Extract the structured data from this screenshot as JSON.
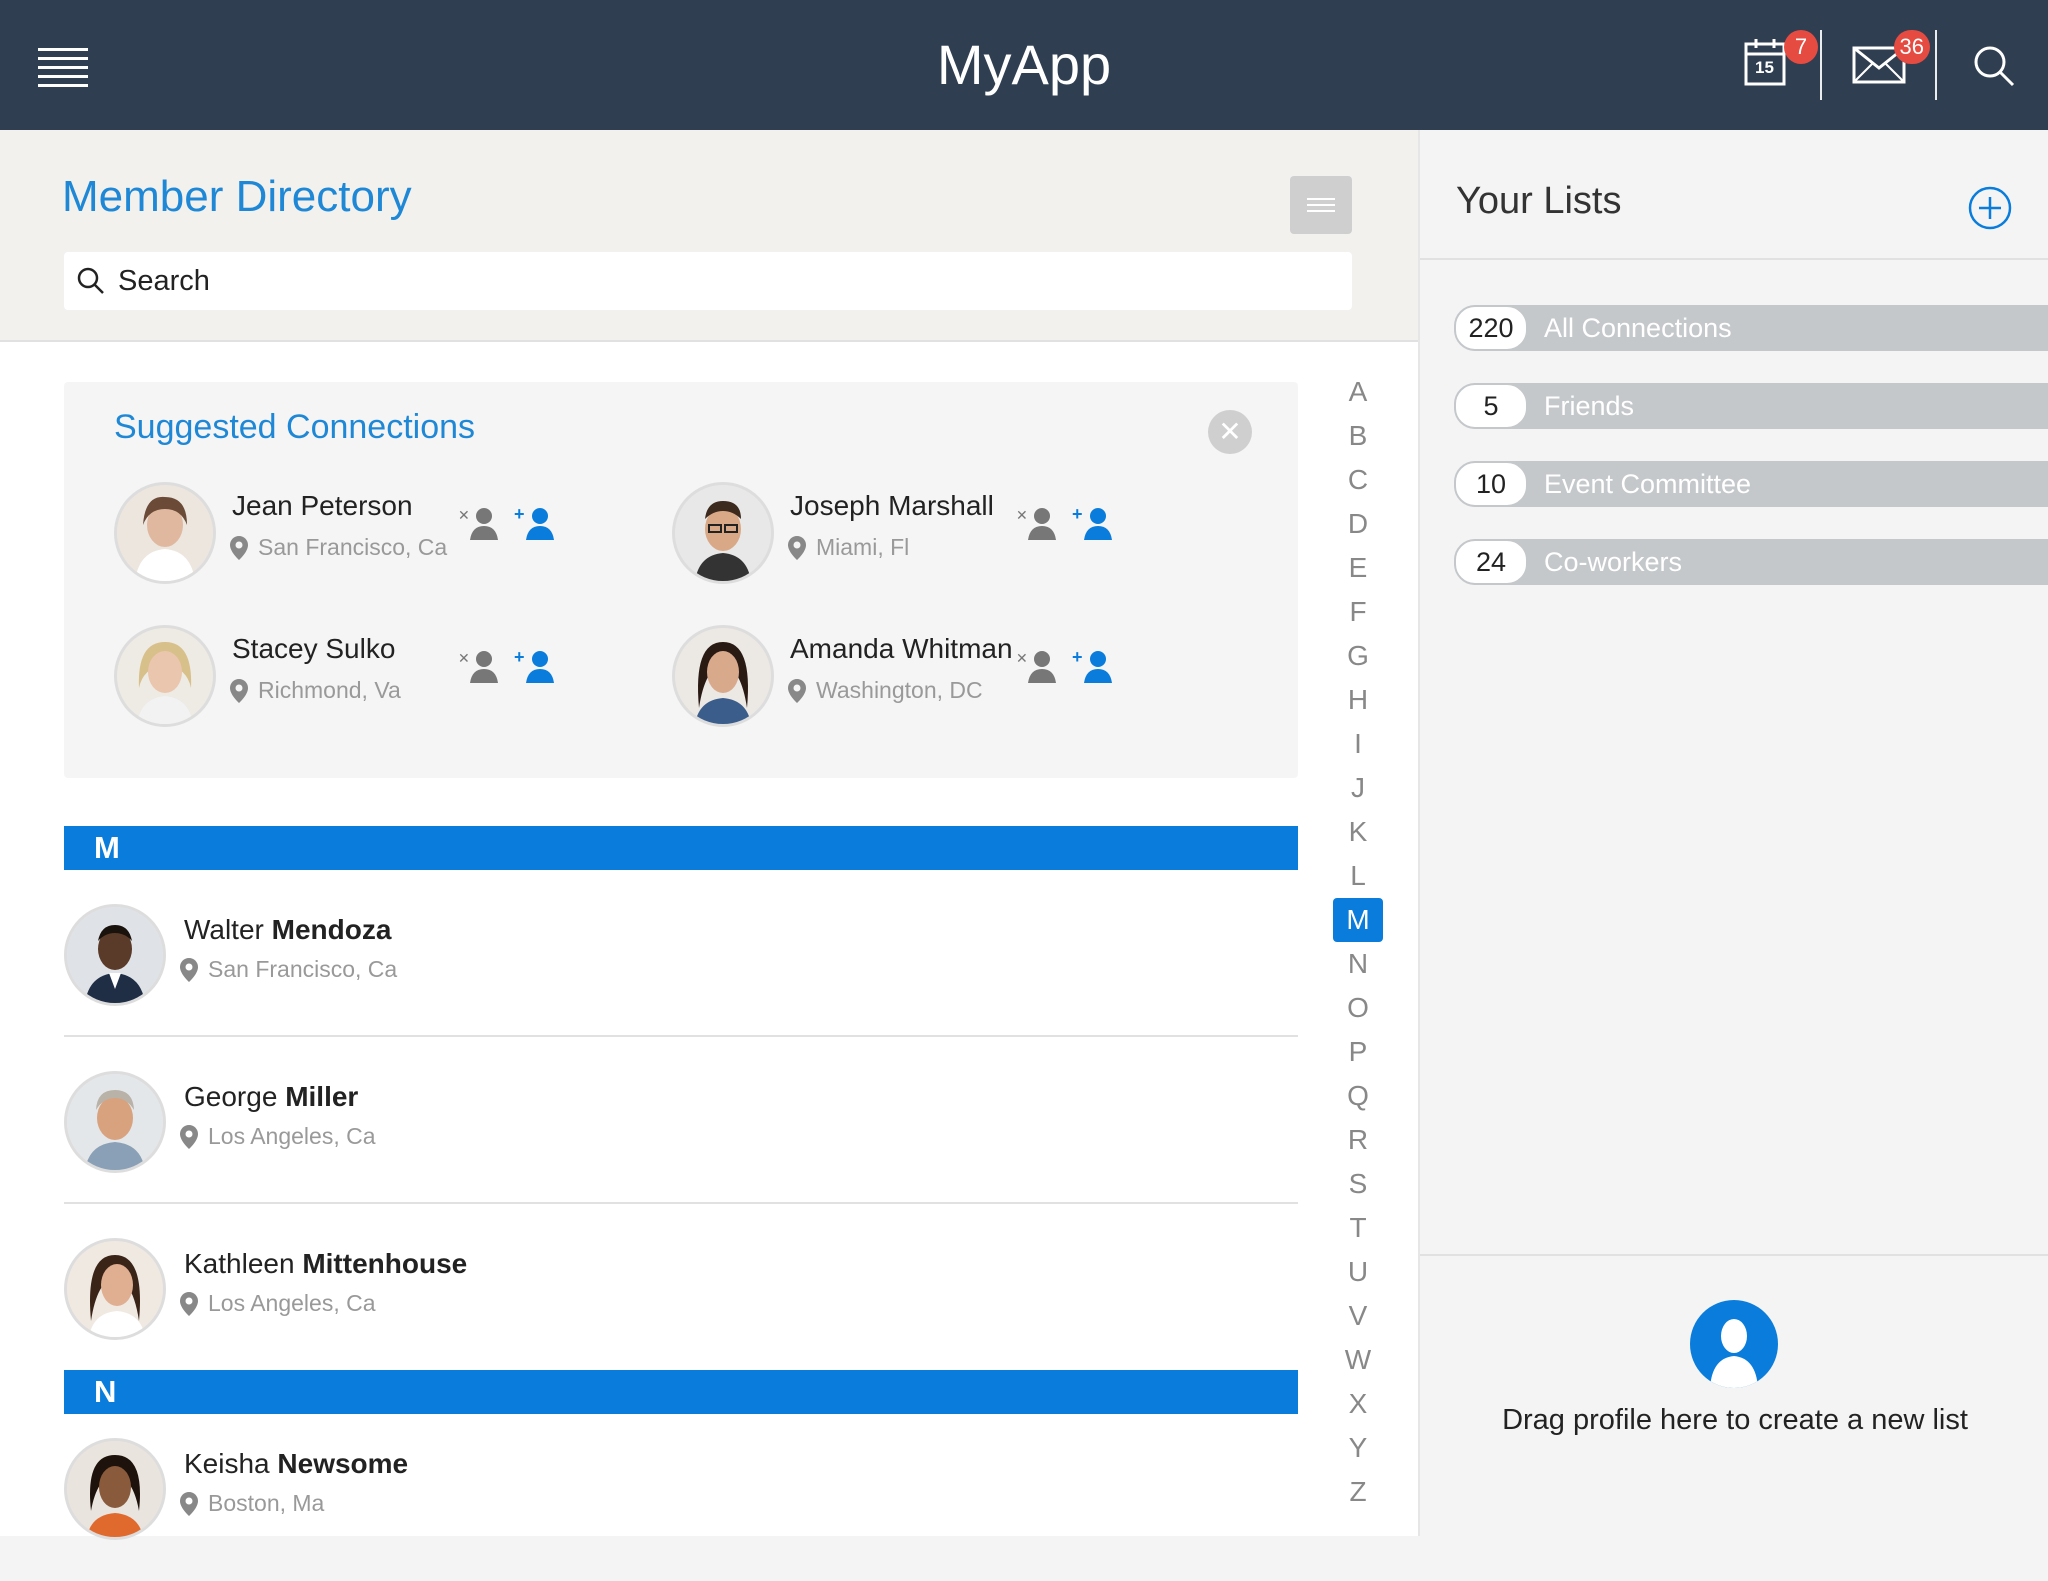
{
  "app": {
    "title": "MyApp"
  },
  "header": {
    "calendar_day": "15",
    "calendar_badge": "7",
    "mail_badge": "36"
  },
  "directory": {
    "title": "Member Directory",
    "search_placeholder": "Search"
  },
  "suggested": {
    "title": "Suggested Connections",
    "people": [
      {
        "name": "Jean Peterson",
        "location": "San Francisco, Ca"
      },
      {
        "name": "Joseph Marshall",
        "location": "Miami, Fl"
      },
      {
        "name": "Stacey Sulko",
        "location": "Richmond, Va"
      },
      {
        "name": "Amanda Whitman",
        "location": "Washington, DC"
      }
    ]
  },
  "sections": [
    {
      "letter": "M",
      "members": [
        {
          "first": "Walter",
          "last": "Mendoza",
          "location": "San Francisco, Ca"
        },
        {
          "first": "George",
          "last": "Miller",
          "location": "Los Angeles, Ca"
        },
        {
          "first": "Kathleen",
          "last": "Mittenhouse",
          "location": "Los Angeles, Ca"
        }
      ]
    },
    {
      "letter": "N",
      "members": [
        {
          "first": "Keisha",
          "last": "Newsome",
          "location": "Boston, Ma"
        }
      ]
    }
  ],
  "alphabet": [
    "A",
    "B",
    "C",
    "D",
    "E",
    "F",
    "G",
    "H",
    "I",
    "J",
    "K",
    "L",
    "M",
    "N",
    "O",
    "P",
    "Q",
    "R",
    "S",
    "T",
    "U",
    "V",
    "W",
    "X",
    "Y",
    "Z"
  ],
  "alphabet_active": "M",
  "lists": {
    "title": "Your Lists",
    "items": [
      {
        "count": "220",
        "label": "All Connections"
      },
      {
        "count": "5",
        "label": "Friends"
      },
      {
        "count": "10",
        "label": "Event Committee"
      },
      {
        "count": "24",
        "label": "Co-workers"
      }
    ],
    "drop_text": "Drag profile here to create a new list"
  },
  "colors": {
    "topbar": "#2f3e51",
    "accent": "#0a7ddc",
    "badge": "#e54b41"
  }
}
